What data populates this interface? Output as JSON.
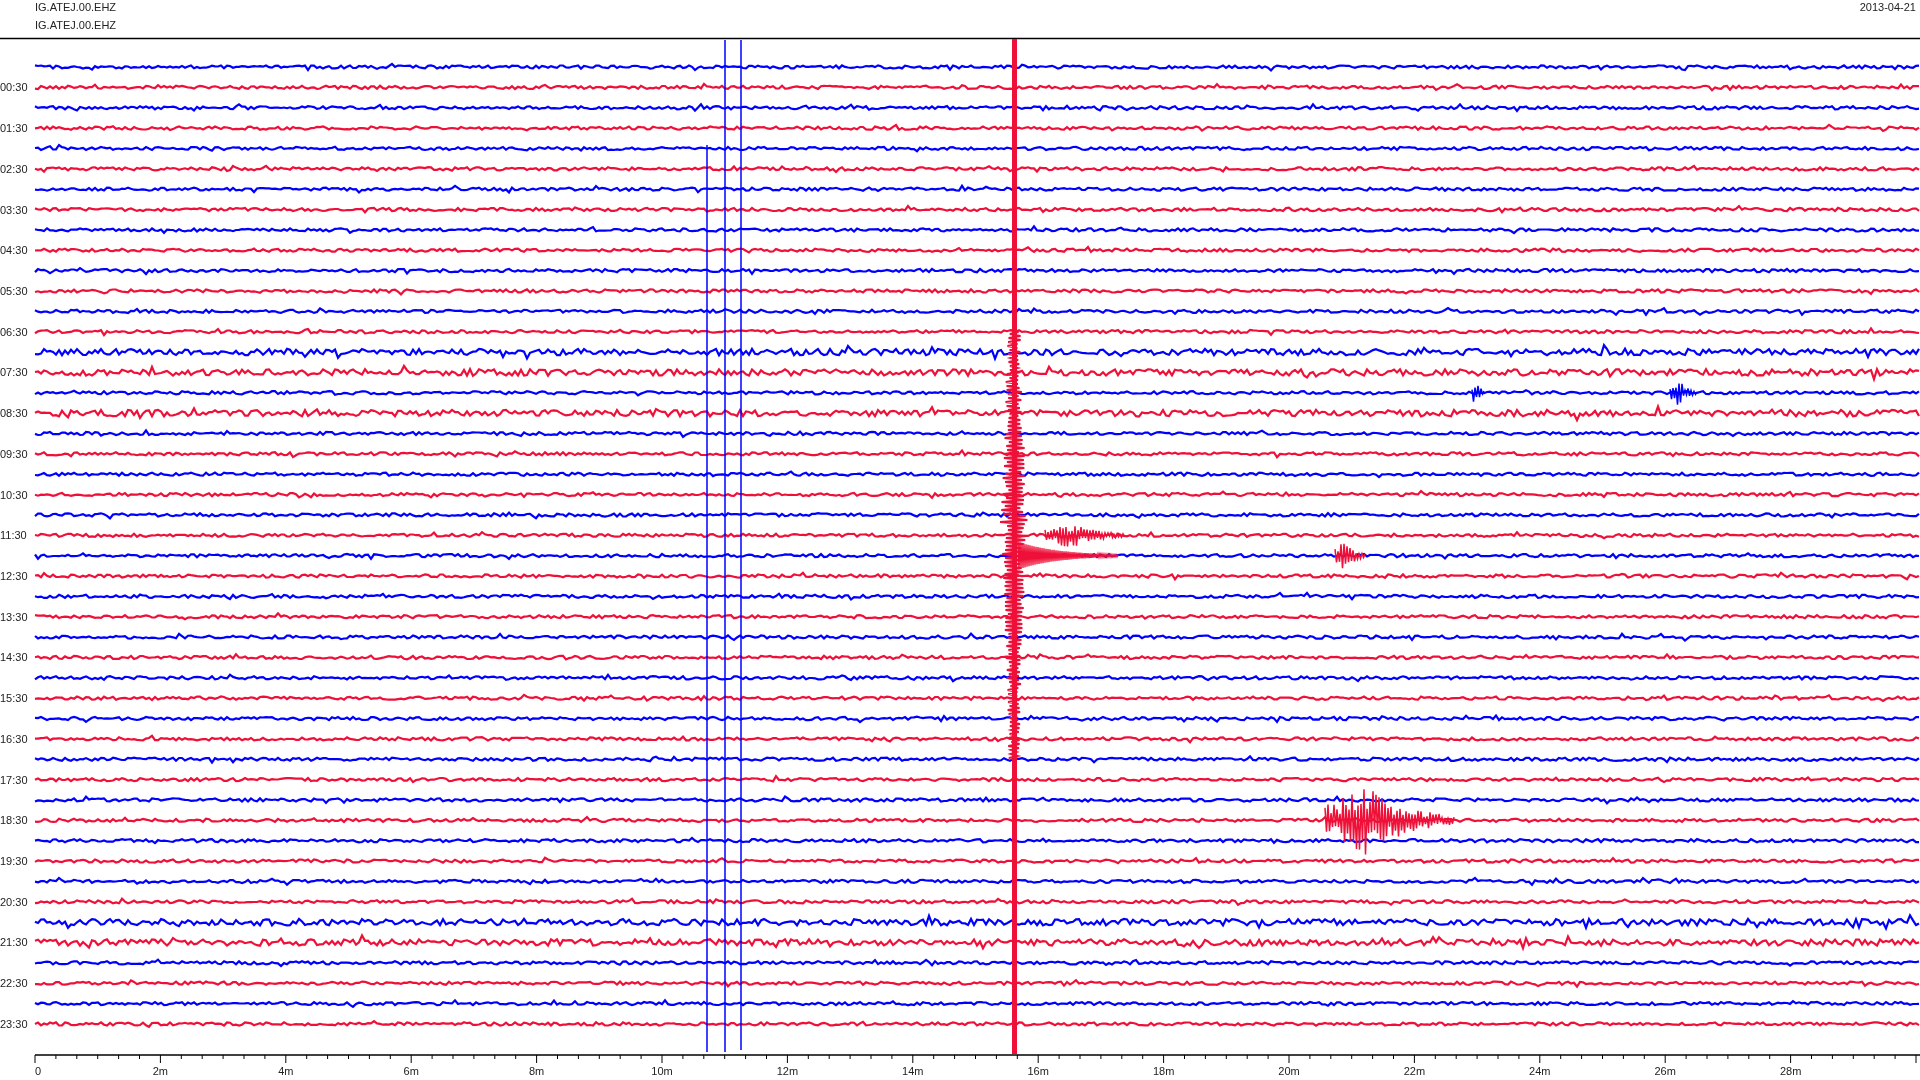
{
  "header": {
    "station_lines": [
      "IG.ATEJ.00.EHZ",
      "IG.ATEJ.00.EHZ"
    ],
    "date": "2013-04-21"
  },
  "row_labels": [
    "00:30",
    "01:30",
    "02:30",
    "03:30",
    "04:30",
    "05:30",
    "06:30",
    "07:30",
    "08:30",
    "09:30",
    "10:30",
    "11:30",
    "12:30",
    "13:30",
    "14:30",
    "15:30",
    "16:30",
    "17:30",
    "18:30",
    "19:30",
    "20:30",
    "21:30",
    "22:30",
    "23:30"
  ],
  "x_axis_labels": [
    "0",
    "2m",
    "4m",
    "6m",
    "8m",
    "10m",
    "12m",
    "14m",
    "16m",
    "18m",
    "20m",
    "22m",
    "24m",
    "26m",
    "28m"
  ]
}
